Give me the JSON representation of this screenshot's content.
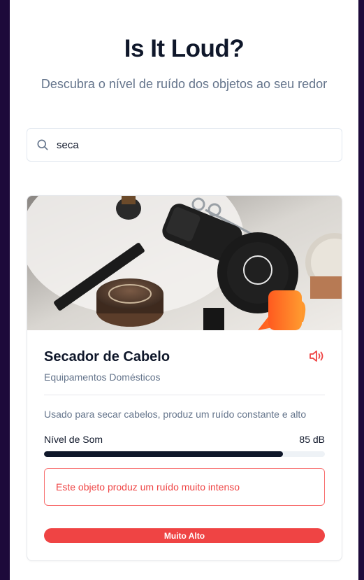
{
  "header": {
    "title": "Is It Loud?",
    "subtitle": "Descubra o nível de ruído dos objetos ao seu redor"
  },
  "search": {
    "value": "seca",
    "icon": "search-icon"
  },
  "results": [
    {
      "name": "Secador de Cabelo",
      "category": "Equipamentos Domésticos",
      "description": "Usado para secar cabelos, produz um ruído constante e alto",
      "level_label": "Nível de Som",
      "level_value": "85 dB",
      "level_fraction": 0.85,
      "alert": "Este objeto produz um ruído muito intenso",
      "badge": "Muito Alto",
      "icon": "volume-icon"
    }
  ],
  "colors": {
    "background": "#1d0a3a",
    "title": "#0f172a",
    "muted": "#64748b",
    "danger": "#ef4444",
    "bar_fill": "#0f172a",
    "bar_track": "#eef2f6"
  }
}
